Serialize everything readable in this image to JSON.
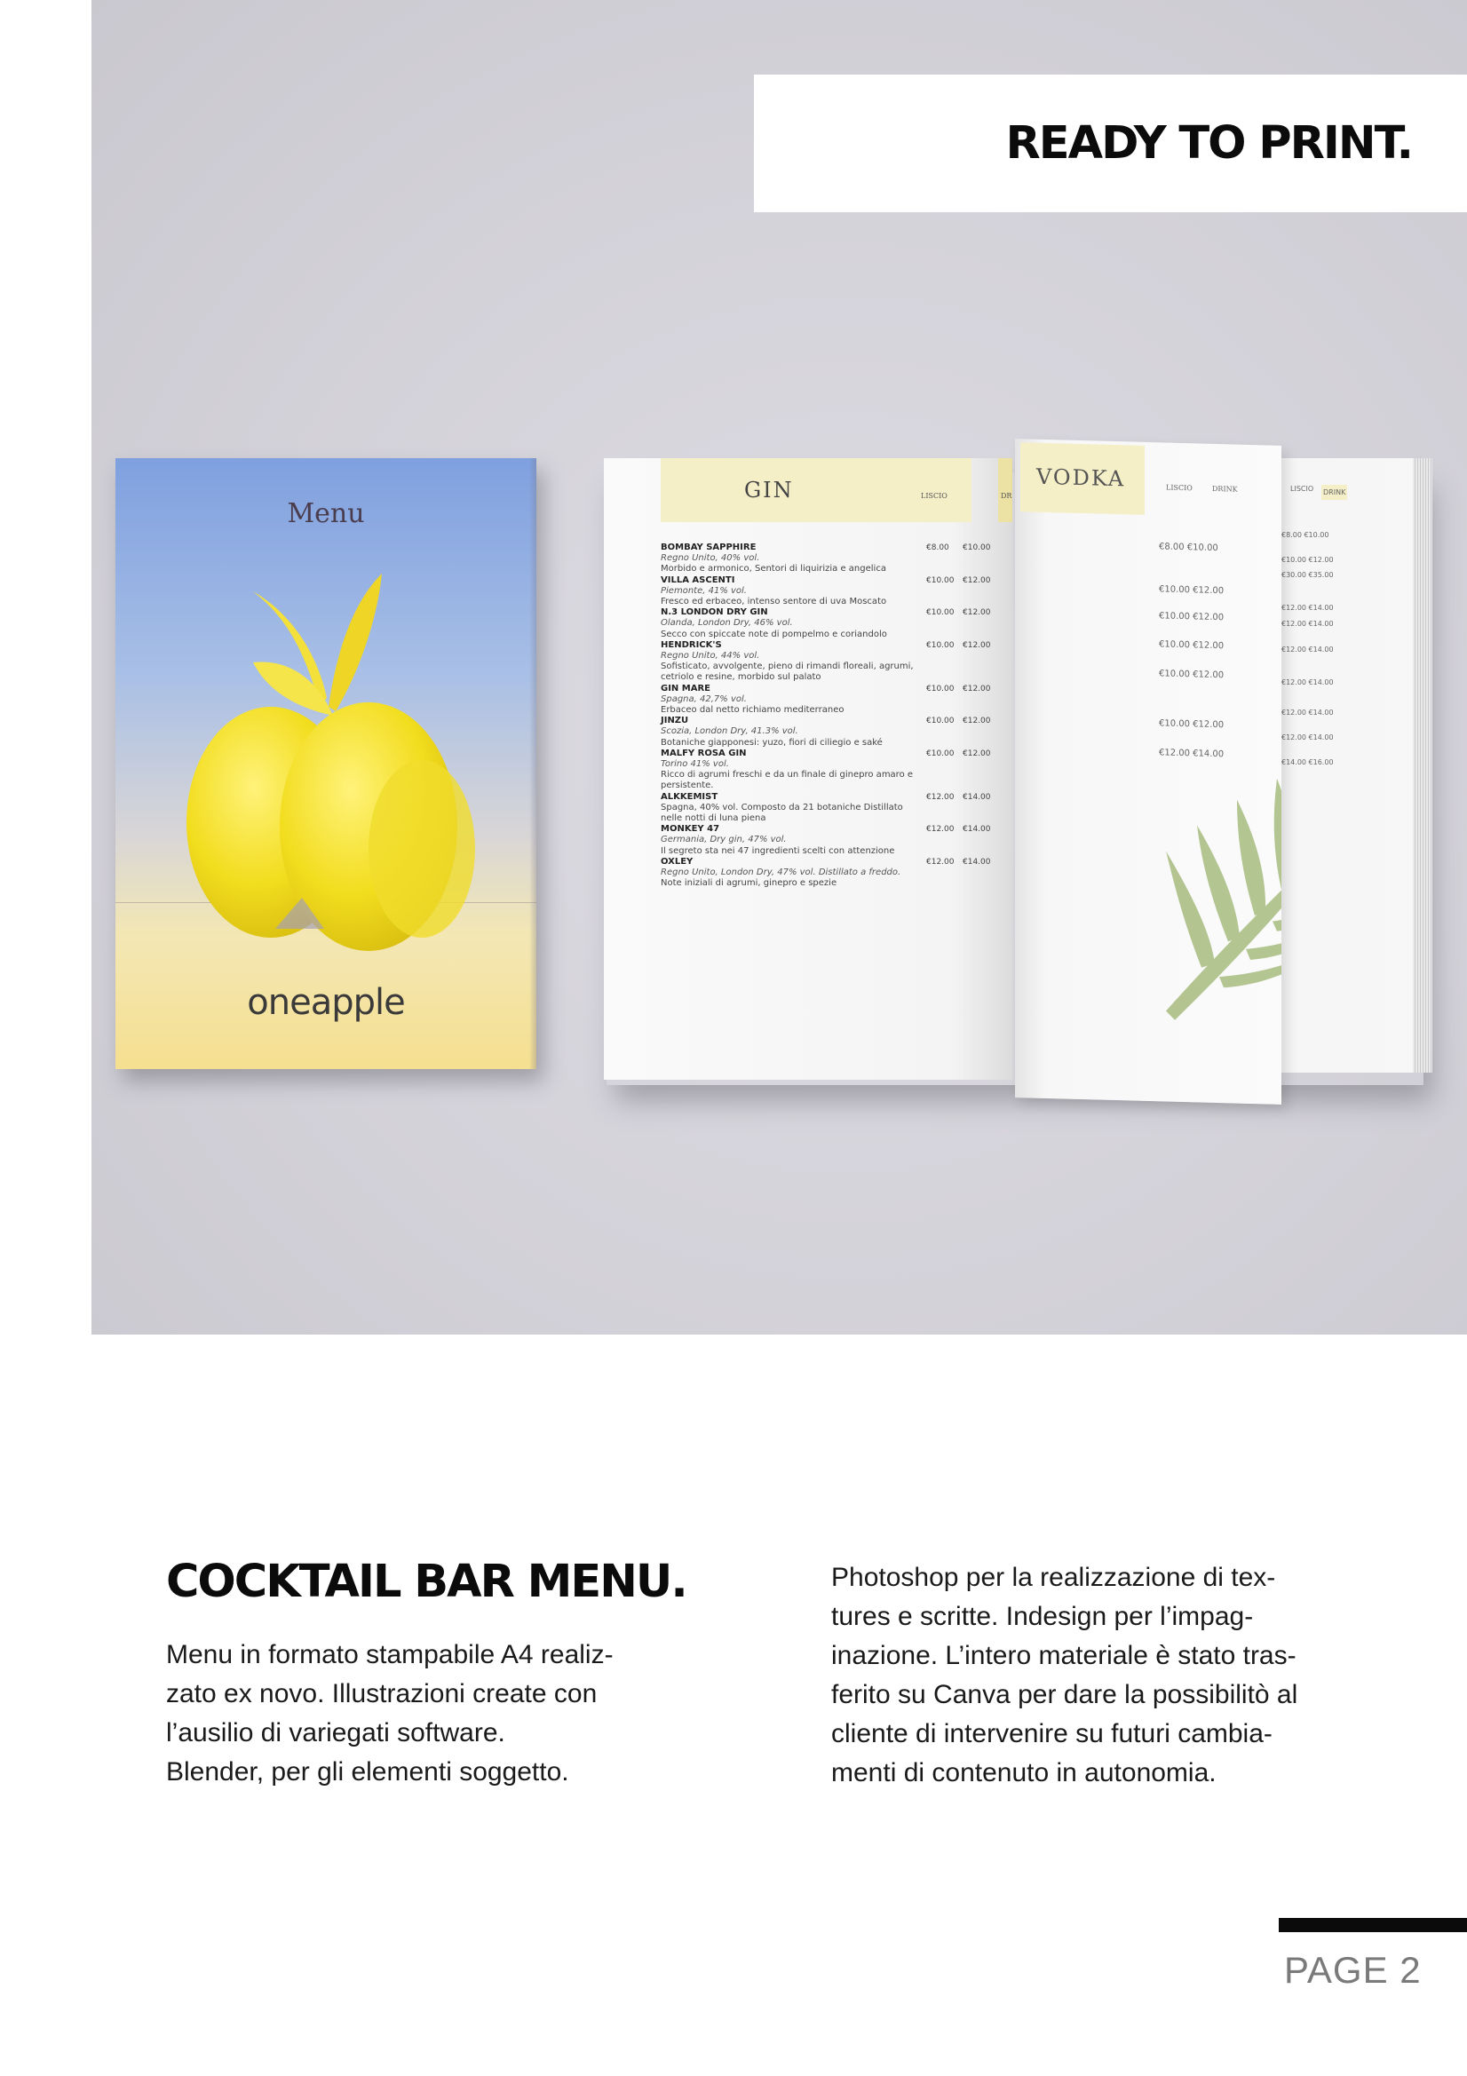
{
  "banner": {
    "title": "READY TO PRINT."
  },
  "mockup": {
    "cover": {
      "title": "Menu",
      "brand": "oneapple"
    },
    "gin_page": {
      "title": "GIN",
      "columns": [
        "LISCIO",
        "DRINK"
      ],
      "items": [
        {
          "name": "BOMBAY SAPPHIRE",
          "origin": "Regno Unito, 40% vol.",
          "description": "Morbido e armonico, Sentori di liquirizia e angelica",
          "liscio": "€8.00",
          "drink": "€10.00"
        },
        {
          "name": "VILLA ASCENTI",
          "origin": "Piemonte, 41% vol.",
          "description": "Fresco ed erbaceo, intenso sentore di uva Moscato",
          "liscio": "€10.00",
          "drink": "€12.00"
        },
        {
          "name": "N.3 LONDON DRY GIN",
          "origin": "Olanda, London Dry, 46% vol.",
          "description": "Secco con spiccate note di pompelmo e coriandolo",
          "liscio": "€10.00",
          "drink": "€12.00"
        },
        {
          "name": "HENDRICK'S",
          "origin": "Regno Unito, 44% vol.",
          "description": "Sofisticato, avvolgente, pieno di rimandi floreali, agrumi, cetriolo e resine, morbido sul palato",
          "liscio": "€10.00",
          "drink": "€12.00"
        },
        {
          "name": "GIN MARE",
          "origin": "Spagna, 42,7% vol.",
          "description": "Erbaceo dal netto richiamo mediterraneo",
          "liscio": "€10.00",
          "drink": "€12.00"
        },
        {
          "name": "JINZU",
          "origin": "Scozia, London Dry, 41.3% vol.",
          "description": "Botaniche giapponesi: yuzo, fiori di ciliegio e saké",
          "liscio": "€10.00",
          "drink": "€12.00"
        },
        {
          "name": "MALFY ROSA GIN",
          "origin": "Torino 41% vol.",
          "description": "Ricco di agrumi freschi e da un finale di ginepro amaro e persistente.",
          "liscio": "€10.00",
          "drink": "€12.00"
        },
        {
          "name": "ALKKEMIST",
          "origin": "",
          "description": "Spagna, 40% vol. Composto da 21 botaniche Distillato nelle notti di luna piena",
          "liscio": "€12.00",
          "drink": "€14.00"
        },
        {
          "name": "MONKEY 47",
          "origin": "Germania, Dry gin, 47% vol.",
          "description": "Il segreto sta nei 47 ingredienti scelti con attenzione",
          "liscio": "€12.00",
          "drink": "€14.00"
        },
        {
          "name": "OXLEY",
          "origin": "Regno Unito, London Dry, 47% vol. Distillato a freddo.",
          "description": "Note iniziali di agrumi, ginepro e spezie",
          "liscio": "€12.00",
          "drink": "€14.00"
        }
      ]
    },
    "vodka_page": {
      "title": "VODKA",
      "columns": [
        "LISCIO",
        "DRINK"
      ],
      "prices": [
        "€8.00  €10.00",
        "€10.00  €12.00",
        "€10.00  €12.00",
        "€10.00  €12.00",
        "€10.00  €12.00",
        "€10.00  €12.00",
        "€12.00  €14.00"
      ]
    },
    "under_page": {
      "columns": [
        "LISCIO",
        "DRINK"
      ],
      "prices": [
        "€8.00  €10.00",
        "€10.00  €12.00",
        "€30.00  €35.00",
        "€12.00  €14.00",
        "€12.00  €14.00",
        "€12.00  €14.00",
        "€12.00  €14.00",
        "€12.00  €14.00",
        "€12.00  €14.00",
        "€14.00  €16.00"
      ]
    }
  },
  "section": {
    "heading": "COCKTAIL BAR MENU.",
    "para1_lines": [
      "Menu in formato stampabile A4 realiz-",
      "zato ex novo. Illustrazioni create con",
      "l’ausilio di variegati software.",
      "Blender, per gli elementi soggetto."
    ],
    "para2_lines": [
      "Photoshop per la realizzazione di tex-",
      "tures e scritte. Indesign per l’impag-",
      "inazione. L’intero materiale è stato tras-",
      "ferito su Canva per dare la possibilitò al",
      "cliente di intervenire su futuri cambia-",
      "menti di contenuto in autonomia."
    ]
  },
  "footer": {
    "page_label": "PAGE 2"
  },
  "colors": {
    "accent_yellow": "#f5efc7",
    "hero_bg": "#d3d1d8",
    "text": "#0b0b0b"
  }
}
